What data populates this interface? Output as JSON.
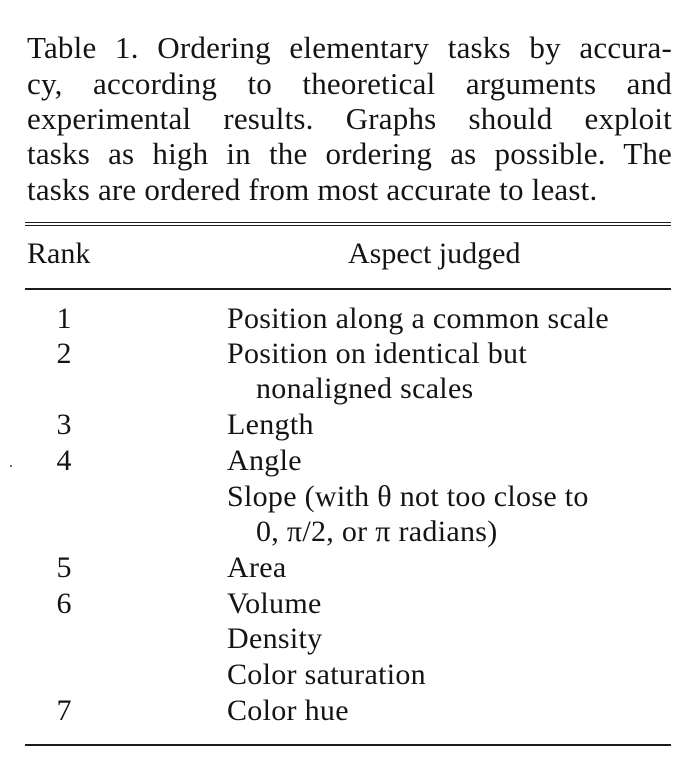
{
  "caption": {
    "lines": [
      "Table 1. Ordering elementary tasks by accura-",
      "cy, according to theoretical arguments and",
      "experimental results. Graphs should exploit",
      "tasks as high in the ordering as possible. The",
      "tasks are ordered from most accurate to least."
    ]
  },
  "table": {
    "headers": {
      "rank": "Rank",
      "aspect": "Aspect judged"
    },
    "rows": [
      {
        "rank": "1",
        "aspect": "Position along a common scale"
      },
      {
        "rank": "2",
        "aspect": "Position on identical but"
      },
      {
        "rank": "",
        "aspect": "nonaligned scales"
      },
      {
        "rank": "3",
        "aspect": "Length"
      },
      {
        "rank": "4",
        "aspect": "Angle"
      },
      {
        "rank": "",
        "aspect": "Slope (with θ not too close to"
      },
      {
        "rank": "",
        "aspect": "0, π/2, or π radians)"
      },
      {
        "rank": "5",
        "aspect": "Area"
      },
      {
        "rank": "6",
        "aspect": "Volume"
      },
      {
        "rank": "",
        "aspect": "Density"
      },
      {
        "rank": "",
        "aspect": "Color saturation"
      },
      {
        "rank": "7",
        "aspect": "Color hue"
      }
    ]
  }
}
